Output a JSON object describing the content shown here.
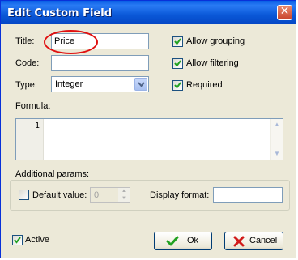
{
  "window": {
    "title": "Edit Custom Field",
    "close_glyph": "✕"
  },
  "fields": {
    "title_label": "Title:",
    "title_value": "Price",
    "code_label": "Code:",
    "code_value": "",
    "type_label": "Type:",
    "type_value": "Integer"
  },
  "options": {
    "allow_grouping": {
      "label": "Allow grouping",
      "checked": true
    },
    "allow_filtering": {
      "label": "Allow filtering",
      "checked": true
    },
    "required": {
      "label": "Required",
      "checked": true
    }
  },
  "formula": {
    "label": "Formula:",
    "line_number": "1",
    "text": ""
  },
  "additional": {
    "label": "Additional params:",
    "default_value_label": "Default value:",
    "default_value_checked": false,
    "default_value": "0",
    "display_format_label": "Display format:",
    "display_format_value": ""
  },
  "footer": {
    "active_label": "Active",
    "active_checked": true,
    "ok_label": "Ok",
    "cancel_label": "Cancel"
  },
  "colors": {
    "titlebar": "#0a58d8",
    "dialog_bg": "#ece9d8",
    "highlight_ring": "#e01010",
    "check_green": "#21a121"
  }
}
